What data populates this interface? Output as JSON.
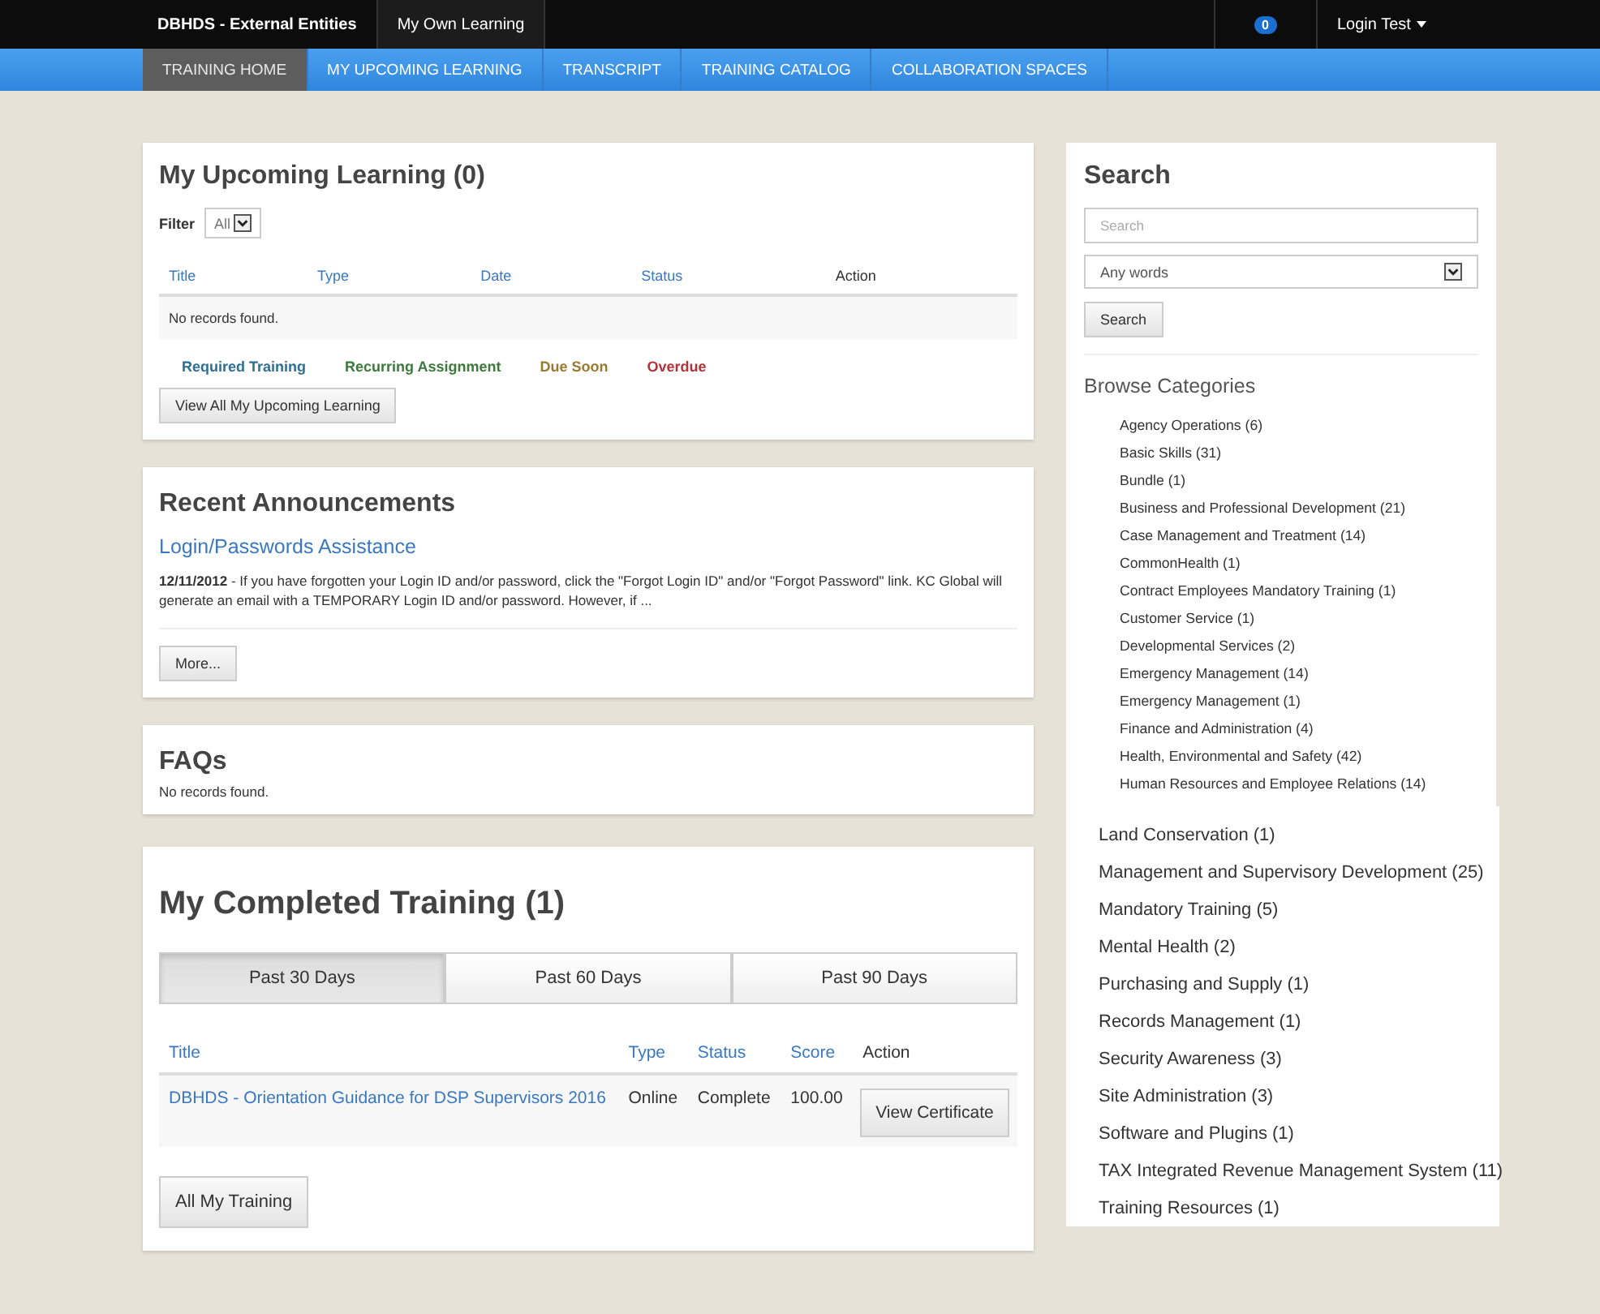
{
  "top_bar": {
    "brand": "DBHDS - External Entities",
    "link": "My Own Learning",
    "notification_count": "0",
    "user": "Login Test"
  },
  "nav_tabs": [
    {
      "label": "TRAINING HOME",
      "selected": true
    },
    {
      "label": "MY UPCOMING LEARNING",
      "selected": false
    },
    {
      "label": "TRANSCRIPT",
      "selected": false
    },
    {
      "label": "TRAINING CATALOG",
      "selected": false
    },
    {
      "label": "COLLABORATION SPACES",
      "selected": false
    }
  ],
  "upcoming": {
    "title": "My Upcoming Learning (0)",
    "filter_label": "Filter",
    "filter_value": "All",
    "columns": [
      {
        "label": "Title",
        "sortable": true
      },
      {
        "label": "Type",
        "sortable": true
      },
      {
        "label": "Date",
        "sortable": true
      },
      {
        "label": "Status",
        "sortable": true
      },
      {
        "label": "Action",
        "sortable": false
      }
    ],
    "empty": "No records found.",
    "legend": [
      {
        "label": "Required Training",
        "color": "#2f6f94"
      },
      {
        "label": "Recurring Assignment",
        "color": "#3b7a3a"
      },
      {
        "label": "Due Soon",
        "color": "#9a7a32"
      },
      {
        "label": "Overdue",
        "color": "#b0343a"
      }
    ],
    "button": "View All My Upcoming Learning"
  },
  "announcements": {
    "title": "Recent Announcements",
    "items": [
      {
        "title": "Login/Passwords Assistance",
        "body": "**12/11/2012** - If you have forgotten your Login ID and/or password, click the \"Forgot Login ID\" and/or \"Forgot Password\" link. KC Global will generate an email with a TEMPORARY Login ID and/or password. However, if ..."
      }
    ],
    "button": "More..."
  },
  "faqs": {
    "title": "FAQs",
    "empty": "No records found."
  },
  "completed": {
    "title": "My Completed Training (1)",
    "tabs": [
      {
        "label": "Past 30 Days",
        "selected": true
      },
      {
        "label": "Past 60 Days",
        "selected": false
      },
      {
        "label": "Past 90 Days",
        "selected": false
      }
    ],
    "columns": [
      {
        "label": "Title",
        "sortable": true
      },
      {
        "label": "Type",
        "sortable": true
      },
      {
        "label": "Status",
        "sortable": true
      },
      {
        "label": "Score",
        "sortable": true
      },
      {
        "label": "Action",
        "sortable": false
      }
    ],
    "rows": [
      {
        "title": "DBHDS - Orientation Guidance for DSP Supervisors 2016",
        "type": "Online",
        "status": "Complete",
        "score": "100.00",
        "action": "View Certificate"
      }
    ],
    "button": "All My Training"
  },
  "search": {
    "title": "Search",
    "placeholder": "Search",
    "mode": "Any words",
    "button": "Search"
  },
  "browse_categories": {
    "title": "Browse Categories",
    "items": [
      "Agency Operations (6)",
      "Basic Skills (31)",
      "Bundle (1)",
      "Business and Professional Development (21)",
      "Case Management and Treatment (14)",
      "CommonHealth (1)",
      "Contract Employees Mandatory Training (1)",
      "Customer Service (1)",
      "Developmental Services (2)",
      "Emergency Management (14)",
      "Emergency Management (1)",
      "Finance and Administration (4)",
      "Health, Environmental and Safety (42)",
      "Human Resources and Employee Relations (14)"
    ],
    "items_continued": [
      "Land Conservation (1)",
      "Management and Supervisory Development (25)",
      "Mandatory Training (5)",
      "Mental Health (2)",
      "Purchasing and Supply (1)",
      "Records Management (1)",
      "Security Awareness (3)",
      "Site Administration (3)",
      "Software and Plugins (1)",
      "TAX Integrated Revenue Management System (11)",
      "Training Resources (1)"
    ]
  }
}
